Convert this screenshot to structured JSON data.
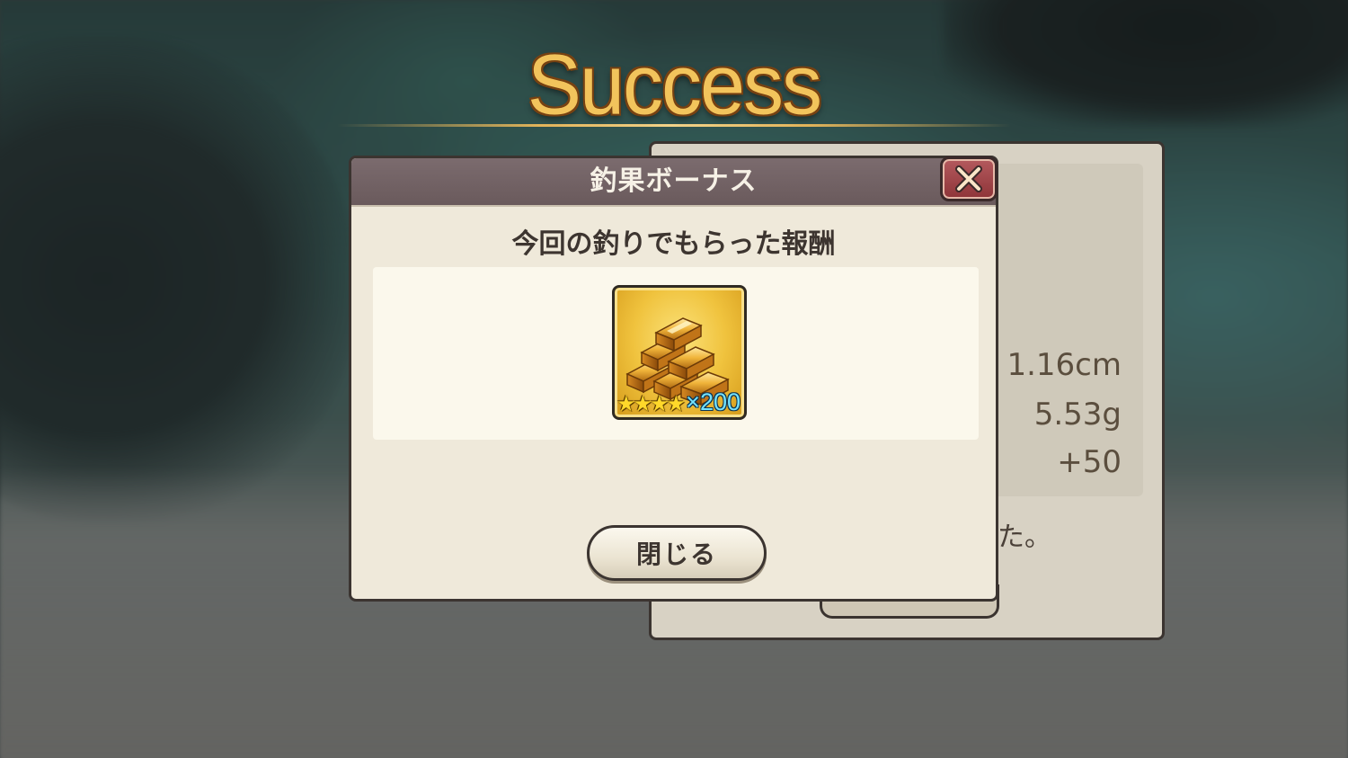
{
  "banner": {
    "title": "Success"
  },
  "dialog": {
    "title": "釣果ボーナス",
    "subtitle": "今回の釣りでもらった報酬",
    "close_icon": "close-x-icon",
    "close_button_label": "閉じる",
    "reward": {
      "icon": "gold-bars-icon",
      "stars": "★★★★",
      "quantity": "×200"
    }
  },
  "result_panel": {
    "size": "1.16cm",
    "weight": "5.53g",
    "points": "+50",
    "message_fragment": "た。"
  },
  "colors": {
    "header": "#6f5f62",
    "dialog_bg": "#efe9da",
    "title_gold": "#f2c45c",
    "close_red": "#a0484c"
  }
}
